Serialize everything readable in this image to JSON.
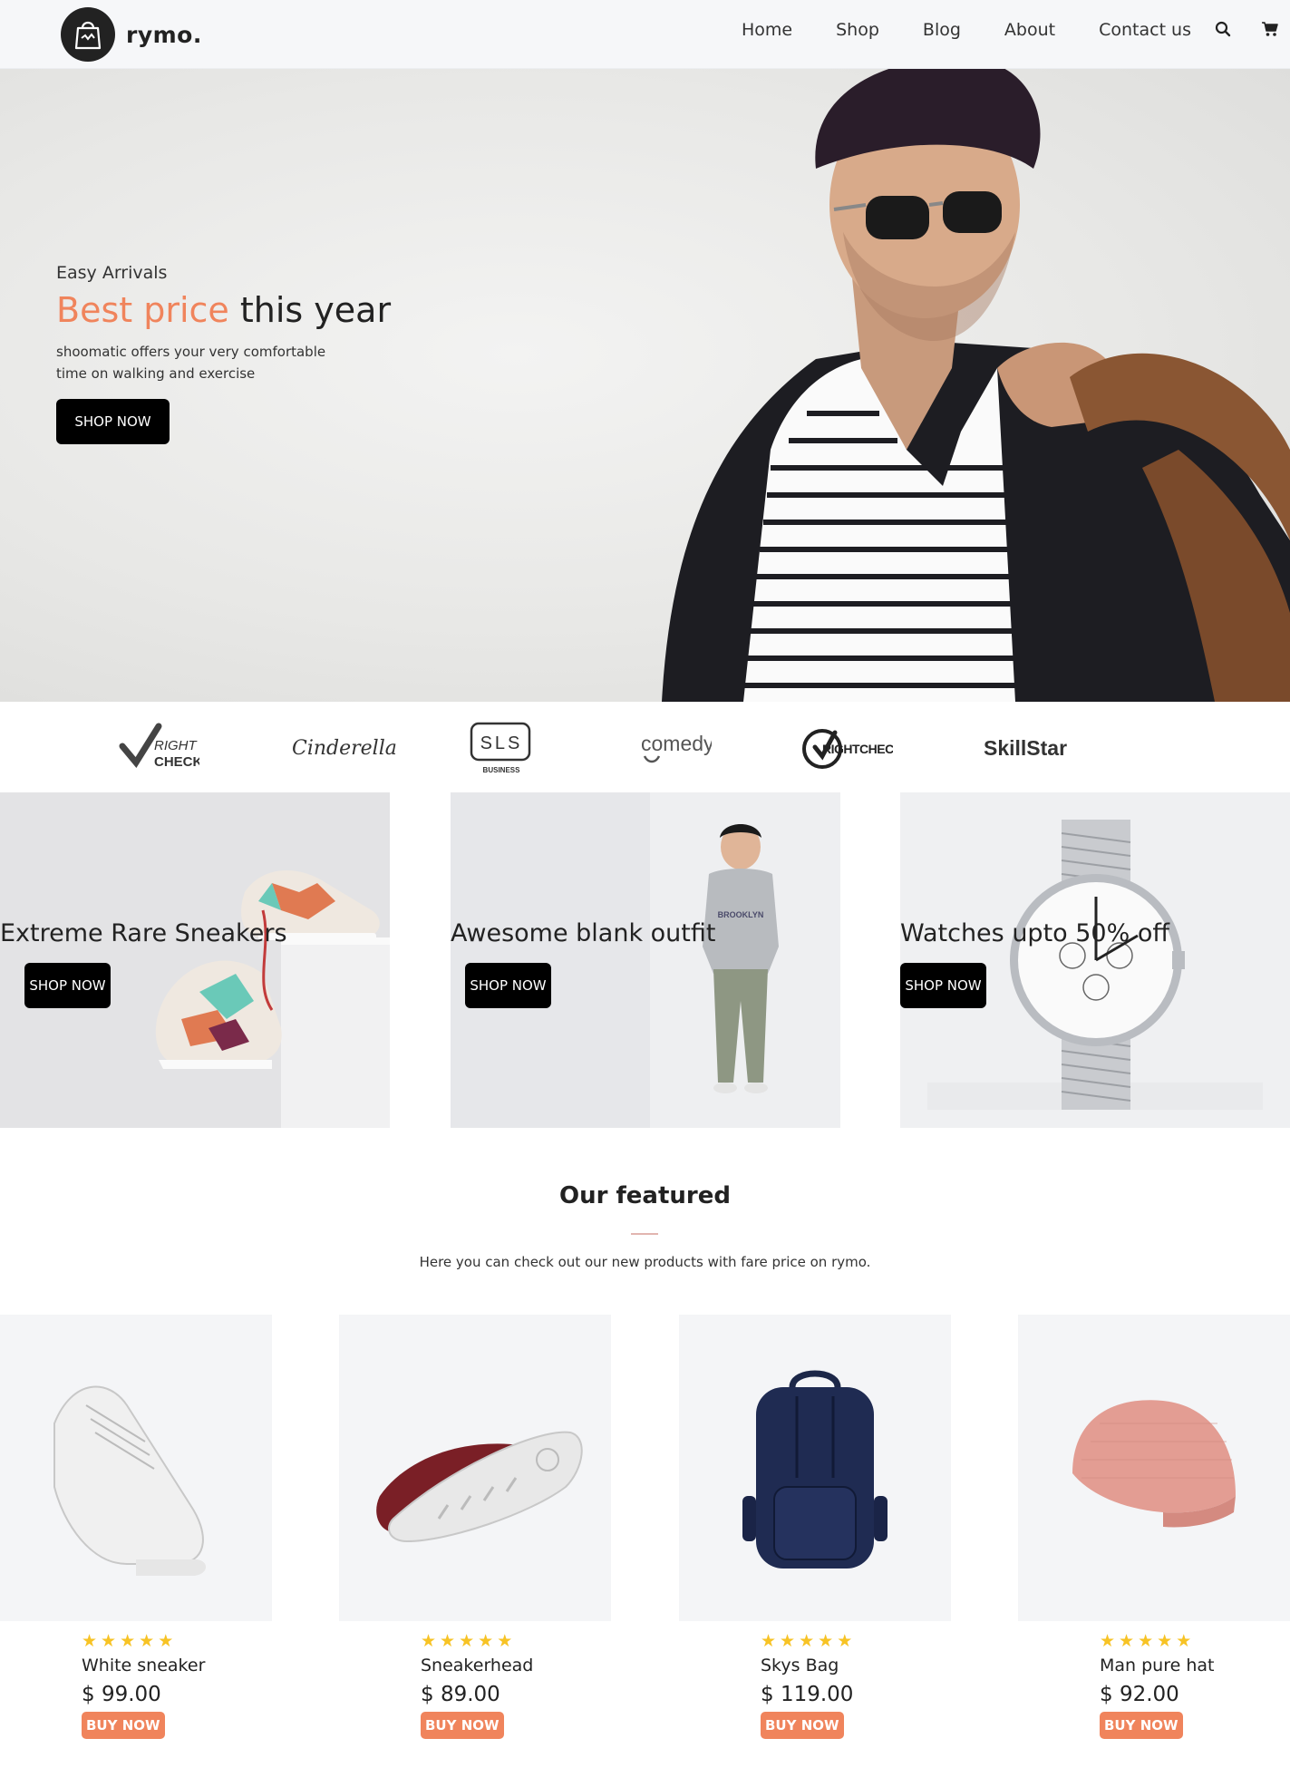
{
  "header": {
    "brand_name": "rymo.",
    "nav": [
      "Home",
      "Shop",
      "Blog",
      "About",
      "Contact us"
    ]
  },
  "hero": {
    "eyebrow": "Easy Arrivals",
    "title_accent": "Best price",
    "title_rest": " this year",
    "description": "shoomatic offers your very comfortable time on walking and exercise",
    "cta": "SHOP NOW"
  },
  "brands": [
    {
      "main": "RIGHT",
      "sub": "CHECK"
    },
    {
      "main": "Cinderella"
    },
    {
      "main": "SLS",
      "sub": "BUSINESS"
    },
    {
      "main": "comedy"
    },
    {
      "main": "RIGHTCHECK"
    },
    {
      "main": "SkillStar"
    }
  ],
  "categories": [
    {
      "title": "Extreme Rare Sneakers",
      "cta": "SHOP NOW"
    },
    {
      "title": "Awesome blank outfit",
      "cta": "SHOP NOW"
    },
    {
      "title": "Watches upto 50% off",
      "cta": "SHOP NOW"
    }
  ],
  "featured": {
    "title": "Our featured",
    "subtitle": "Here you can check out our new products with fare price on rymo.",
    "products": [
      {
        "name": "White sneaker",
        "price": "$ 99.00",
        "rating": 5,
        "cta": "BUY NOW"
      },
      {
        "name": "Sneakerhead",
        "price": "$ 89.00",
        "rating": 5,
        "cta": "BUY NOW"
      },
      {
        "name": "Skys Bag",
        "price": "$ 119.00",
        "rating": 5,
        "cta": "BUY NOW"
      },
      {
        "name": "Man pure hat",
        "price": "$ 92.00",
        "rating": 5,
        "cta": "BUY NOW"
      }
    ]
  },
  "colors": {
    "accent": "#f0845c",
    "dark": "#000000",
    "star": "#f7c325"
  },
  "icons": [
    "shopping-bag-logo-icon",
    "search-icon",
    "cart-icon",
    "star-icon"
  ]
}
